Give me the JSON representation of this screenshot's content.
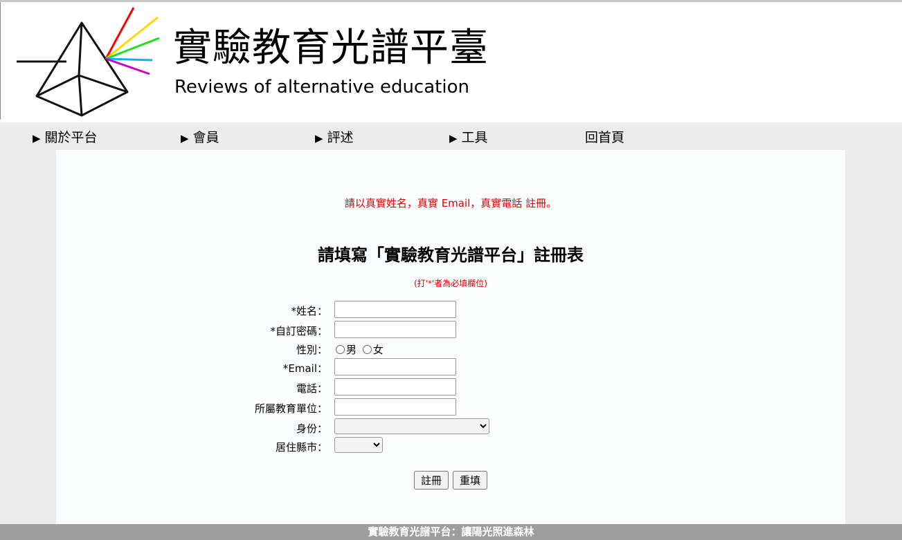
{
  "header": {
    "title": "實驗教育光譜平臺",
    "subtitle": "Reviews of alternative education",
    "spectrum_colors": [
      "#ff0000",
      "#ffd800",
      "#22dd22",
      "#00b4ff",
      "#cc00cc"
    ]
  },
  "nav": {
    "items": [
      {
        "arrow": "▶",
        "label": "關於平台"
      },
      {
        "arrow": "▶",
        "label": "會員"
      },
      {
        "arrow": "▶",
        "label": "評述"
      },
      {
        "arrow": "▶",
        "label": "工具"
      },
      {
        "arrow": "",
        "label": "回首頁"
      }
    ]
  },
  "form": {
    "notice": "請以真實姓名，真實 Email，真實電話 註冊。",
    "title": "請填寫「實驗教育光譜平台」註冊表",
    "required_note": "(打'*'者為必填欄位)",
    "fields": {
      "name_label": "*姓名：",
      "name_value": "",
      "password_label": "*自訂密碼：",
      "password_value": "",
      "gender_label": "性別：",
      "gender_male": "男",
      "gender_female": "女",
      "email_label": "*Email：",
      "email_value": "",
      "phone_label": "電話：",
      "phone_value": "",
      "unit_label": "所屬教育單位：",
      "unit_value": "",
      "identity_label": "身份：",
      "identity_selected": "",
      "city_label": "居住縣市：",
      "city_selected": ""
    },
    "submit_label": "註冊",
    "reset_label": "重填"
  },
  "footer": {
    "text": "實驗教育光譜平台：讓陽光照進森林"
  }
}
